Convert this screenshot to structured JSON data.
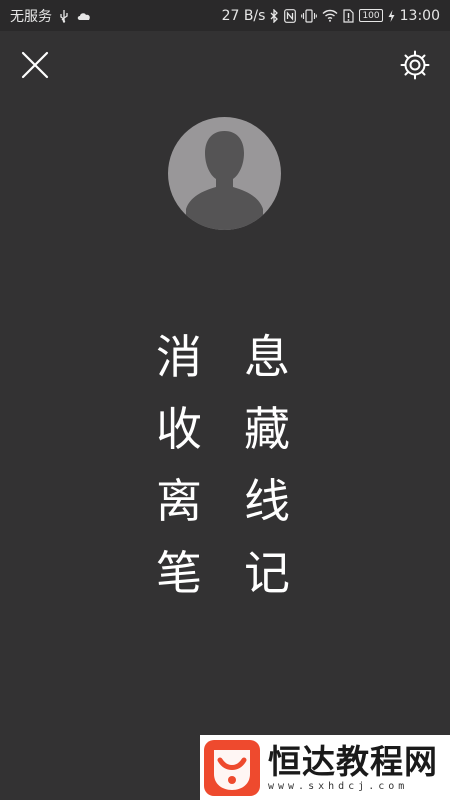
{
  "status_bar": {
    "carrier": "无服务",
    "speed": "27 B/s",
    "battery": "100",
    "time": "13:00"
  },
  "menu": [
    {
      "chars": [
        "消",
        "息"
      ]
    },
    {
      "chars": [
        "收",
        "藏"
      ]
    },
    {
      "chars": [
        "离",
        "线"
      ]
    },
    {
      "chars": [
        "笔",
        "记"
      ]
    }
  ],
  "watermark": {
    "title": "恒达教程网",
    "url": "www.sxhdcj.com"
  },
  "colors": {
    "background": "#333233",
    "avatar_bg": "#999799",
    "text": "#ffffff",
    "watermark_logo": "#ee4a2e"
  }
}
